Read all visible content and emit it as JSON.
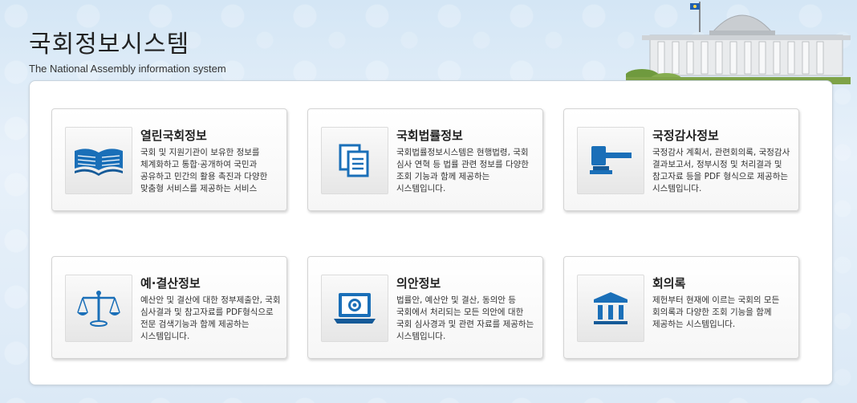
{
  "header": {
    "title": "국회정보시스템",
    "subtitle": "The National Assembly information system"
  },
  "colors": {
    "icon_blue": "#1a6fb8",
    "icon_dark": "#155a98"
  },
  "cards": [
    {
      "title": "열린국회정보",
      "description": "국회 및 지원기관이 보유한 정보를 체계화하고 통합·공개하여 국민과 공유하고 민간의 활용 촉진과 다양한 맞춤형 서비스를 제공하는 서비스",
      "icon": "open-book-icon"
    },
    {
      "title": "국회법률정보",
      "description": "국회법률정보시스템은 현행법령, 국회 심사 연혁 등 법률 관련 정보를 다양한 조회 기능과 함께 제공하는 시스템입니다.",
      "icon": "documents-icon"
    },
    {
      "title": "국정감사정보",
      "description": "국정감사 계획서, 관련회의록, 국정감사 결과보고서, 정부시정 및 처리결과 및 참고자료 등을 PDF 형식으로 제공하는 시스템입니다.",
      "icon": "gavel-icon"
    },
    {
      "title": "예·결산정보",
      "description": "예산안 및 결산에 대한 정부제출안, 국회 심사결과 및 참고자료를 PDF형식으로 전문 검색기능과 함께 제공하는 시스템입니다.",
      "icon": "scales-icon"
    },
    {
      "title": "의안정보",
      "description": "법률안, 예산안 및 결산, 동의안 등 국회에서 처리되는 모든 의안에 대한 국회 심사경과 및 관련 자료를 제공하는 시스템입니다.",
      "icon": "laptop-emblem-icon"
    },
    {
      "title": "회의록",
      "description": "제헌부터 현재에 이르는 국회의 모든 회의록과 다양한 조회 기능을 함께 제공하는 시스템입니다.",
      "icon": "pillars-building-icon"
    }
  ]
}
